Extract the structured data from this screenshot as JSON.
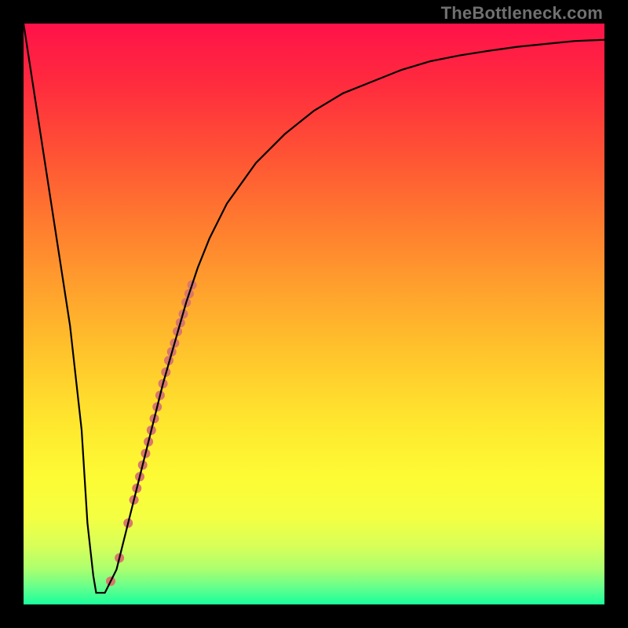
{
  "watermark": "TheBottleneck.com",
  "chart_data": {
    "type": "line",
    "title": "",
    "xlabel": "",
    "ylabel": "",
    "xlim": [
      0,
      100
    ],
    "ylim": [
      0,
      100
    ],
    "grid": false,
    "background_gradient": {
      "top": "#ff124a",
      "bottom": "#1aff9c"
    },
    "series": [
      {
        "name": "curve",
        "color": "#000000",
        "x": [
          0,
          4,
          8,
          10,
          11,
          12,
          12.5,
          14,
          16,
          18,
          20,
          22,
          24,
          26,
          28,
          30,
          32,
          35,
          40,
          45,
          50,
          55,
          60,
          65,
          70,
          75,
          80,
          85,
          90,
          95,
          100
        ],
        "y": [
          100,
          74,
          48,
          30,
          14,
          5,
          2,
          2,
          6,
          14,
          22,
          30,
          38,
          45,
          52,
          58,
          63,
          69,
          76,
          81,
          85,
          88,
          90,
          92,
          93.5,
          94.5,
          95.3,
          96,
          96.5,
          97,
          97.2
        ]
      }
    ],
    "markers": [
      {
        "name": "dot-cluster",
        "color": "#d8786a",
        "radius_px": 6,
        "x": [
          15.0,
          16.5,
          18.0,
          19.0,
          19.5,
          20.0,
          20.5,
          21.0,
          21.5,
          22.0,
          22.5,
          23.0,
          23.5,
          24.0,
          24.5,
          25.0,
          25.5,
          26.0,
          26.5,
          27.0,
          27.5,
          28.0,
          28.5,
          29.0
        ],
        "y": [
          4.0,
          8.0,
          14.0,
          18.0,
          20.0,
          22.0,
          24.0,
          26.0,
          28.0,
          30.0,
          32.0,
          34.0,
          36.0,
          38.0,
          40.0,
          42.0,
          43.5,
          45.0,
          47.0,
          48.5,
          50.0,
          52.0,
          53.5,
          55.0
        ]
      }
    ]
  }
}
